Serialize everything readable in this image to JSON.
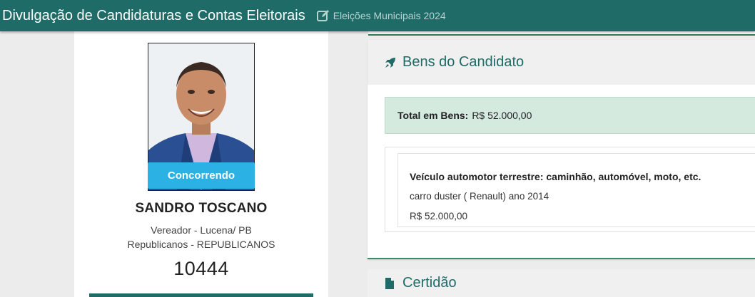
{
  "header": {
    "app_title": "Divulgação de Candidaturas e Contas Eleitorais",
    "election": "Eleições Municipais 2024",
    "icon": "edit-icon",
    "bg_color": "#1e6b67"
  },
  "candidate": {
    "status": "Concorrendo",
    "name": "SANDRO TOSCANO",
    "role": "Vereador - Lucena/ PB",
    "party": "Republicanos - REPUBLICANOS",
    "number": "10444"
  },
  "bens": {
    "title": "Bens do Candidato",
    "icon": "rocket-icon",
    "total_label": "Total em Bens:",
    "total_value": "R$ 52.000,00",
    "items": [
      {
        "type": "Veículo automotor terrestre: caminhão, automóvel, moto, etc.",
        "description": "carro duster ( Renault) ano 2014",
        "value": "R$ 52.000,00"
      }
    ]
  },
  "certidao": {
    "title": "Certidão",
    "icon": "file-icon"
  },
  "colors": {
    "accent": "#1e6b67",
    "status_badge": "#2bb1e3",
    "total_bg": "#d5eadf"
  }
}
